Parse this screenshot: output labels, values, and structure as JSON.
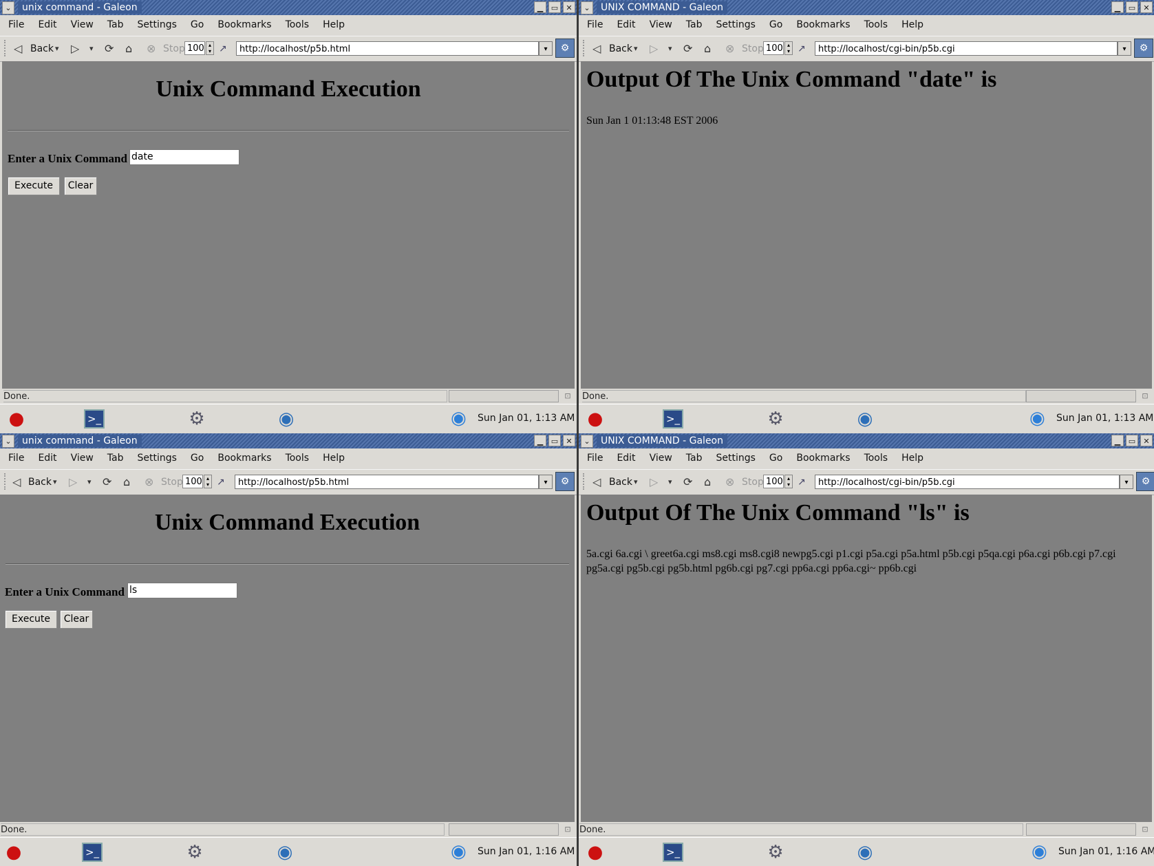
{
  "common": {
    "menu_items": [
      "File",
      "Edit",
      "View",
      "Tab",
      "Settings",
      "Go",
      "Bookmarks",
      "Tools",
      "Help"
    ],
    "back_label": "Back",
    "stop_label": "Stop",
    "zoom_value": "100",
    "status_text": "Done.",
    "icons": {
      "back": "◁",
      "forward": "▷",
      "reload": "⟳",
      "home": "⌂",
      "stop": "⊗",
      "dropdown": "▾",
      "redhat": "●",
      "terminal": ">_",
      "gear": "⚙",
      "globe": "◉",
      "throbber": "⚙"
    }
  },
  "windows": {
    "top_left": {
      "title": "unix command - Galeon",
      "url": "http://localhost/p5b.html",
      "heading": "Unix Command Execution",
      "form_label": "Enter a Unix Command",
      "input_value": "date",
      "execute_label": "Execute",
      "clear_label": "Clear",
      "clock": "Sun Jan 01,  1:13 AM"
    },
    "top_right": {
      "title": "UNIX COMMAND - Galeon",
      "url": "http://localhost/cgi-bin/p5b.cgi",
      "heading": "Output Of The Unix Command \"date\" is",
      "output": "Sun Jan 1 01:13:48 EST 2006",
      "clock": "Sun Jan 01,  1:13 AM"
    },
    "bottom_left": {
      "title": "unix command - Galeon",
      "url": "http://localhost/p5b.html",
      "heading": "Unix Command Execution",
      "form_label": "Enter a Unix Command",
      "input_value": "ls",
      "execute_label": "Execute",
      "clear_label": "Clear",
      "clock": "Sun Jan 01,  1:16 AM"
    },
    "bottom_right": {
      "title": "UNIX COMMAND - Galeon",
      "url": "http://localhost/cgi-bin/p5b.cgi",
      "heading": "Output Of The Unix Command \"ls\" is",
      "output": "5a.cgi 6a.cgi \\ greet6a.cgi ms8.cgi ms8.cgi8 newpg5.cgi p1.cgi p5a.cgi p5a.html p5b.cgi p5qa.cgi p6a.cgi p6b.cgi p7.cgi pg5a.cgi pg5b.cgi pg5b.html pg6b.cgi pg7.cgi pp6a.cgi pp6a.cgi~ pp6b.cgi",
      "clock": "Sun Jan 01,  1:16 AM"
    }
  }
}
